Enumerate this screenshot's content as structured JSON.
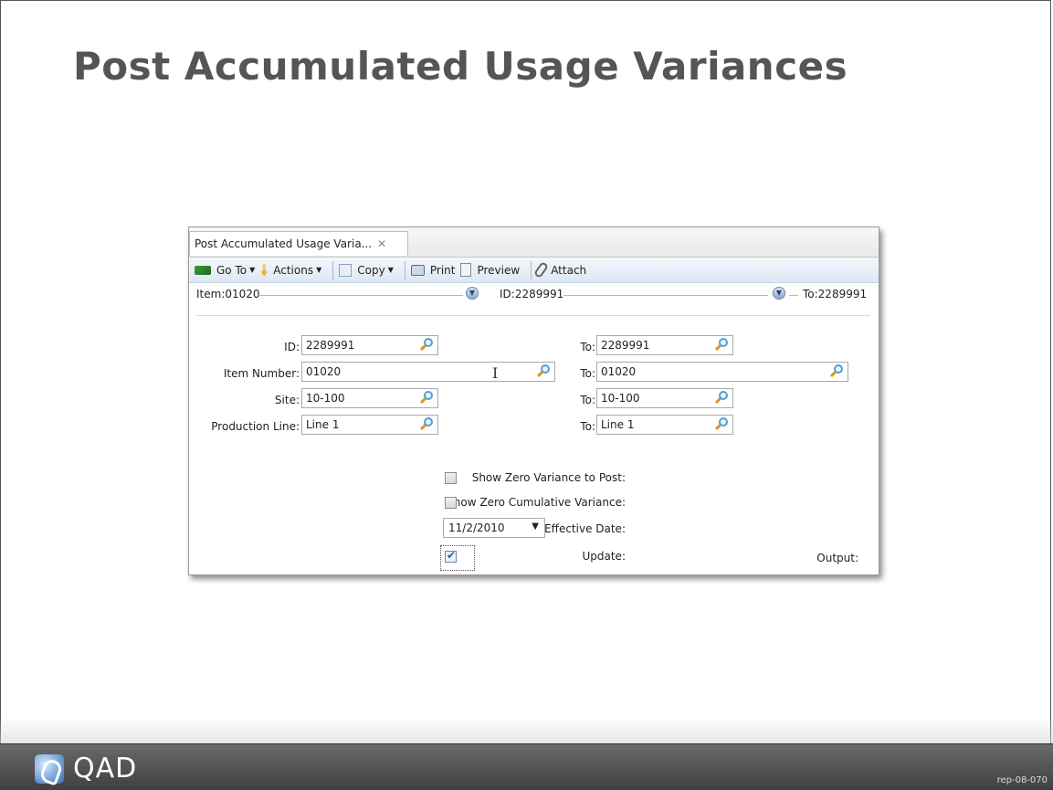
{
  "slide": {
    "title": "Post Accumulated Usage Variances",
    "brand": "QAD",
    "code": "rep-08-070"
  },
  "window": {
    "tab_label": "Post Accumulated Usage Varia...",
    "tab_close": "✕",
    "toolbar": {
      "goto": "Go To",
      "actions": "Actions",
      "copy": "Copy",
      "print": "Print",
      "preview": "Preview",
      "attach": "Attach"
    },
    "breadcrumb": {
      "item": "Item:01020",
      "id": "ID:2289991",
      "to": "To:2289991"
    },
    "form": {
      "id_label": "ID:",
      "id_value": "2289991",
      "id_to_label": "To:",
      "id_to_value": "2289991",
      "item_label": "Item Number:",
      "item_value": "01020",
      "item_to_label": "To:",
      "item_to_value": "01020",
      "site_label": "Site:",
      "site_value": "10-100",
      "site_to_label": "To:",
      "site_to_value": "10-100",
      "line_label": "Production Line:",
      "line_value": "Line 1",
      "line_to_label": "To:",
      "line_to_value": "Line 1",
      "zero_variance_label": "Show Zero Variance to Post:",
      "zero_variance_checked": false,
      "zero_cumulative_label": "Show Zero Cumulative Variance:",
      "zero_cumulative_checked": false,
      "effective_date_label": "Effective Date:",
      "effective_date_value": "11/2/2010",
      "update_label": "Update:",
      "update_checked": true,
      "output_label": "Output:"
    }
  }
}
